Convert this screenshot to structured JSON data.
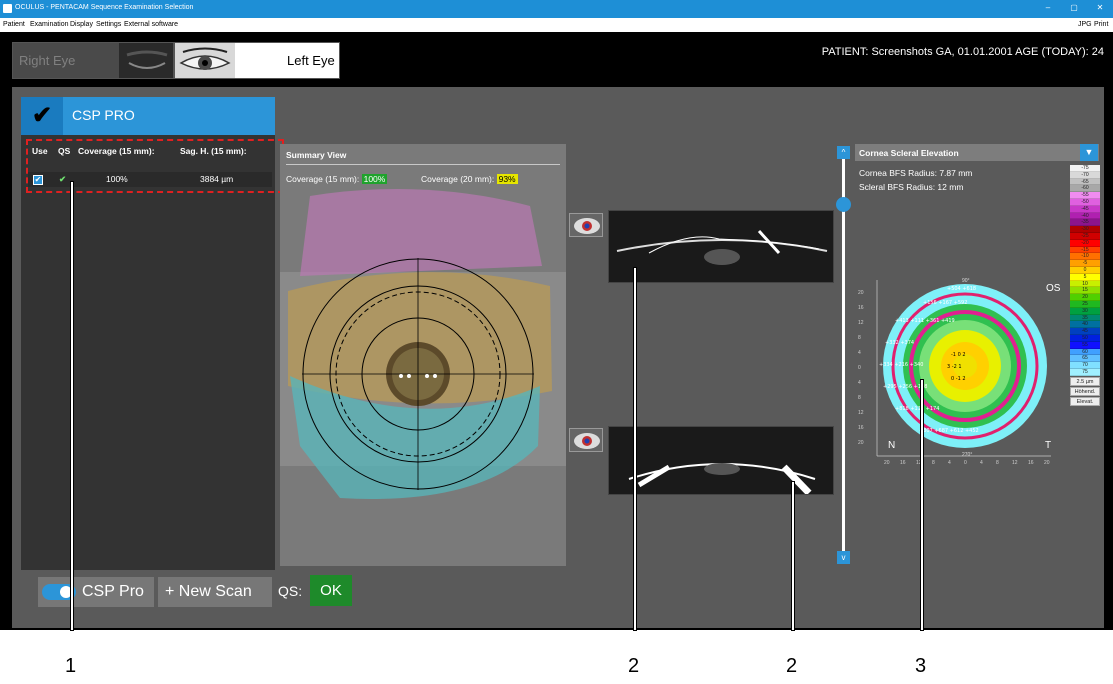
{
  "window": {
    "title": "OCULUS - PENTACAM Sequence Examination Selection",
    "controls": [
      "–",
      "▢",
      "✕"
    ]
  },
  "menu": {
    "items": [
      "Patient",
      "Examination",
      "Display",
      "Settings",
      "External software"
    ],
    "right_items": [
      "JPG",
      "Print"
    ]
  },
  "eyes": {
    "right_label": "Right Eye",
    "left_label": "Left Eye",
    "selected": "Left Eye"
  },
  "patient_info": "PATIENT: Screenshots GA, 01.01.2001   AGE (TODAY): 24",
  "csp": {
    "check": "✔",
    "title": "CSP PRO"
  },
  "scan_table": {
    "headers": [
      "Use",
      "QS",
      "Coverage (15 mm):",
      "Sag. H. (15 mm):"
    ],
    "rows": [
      {
        "use": "✔",
        "qs": "✔",
        "coverage": "100%",
        "sag": "3884 µm"
      }
    ]
  },
  "summary": {
    "title": "Summary View",
    "coverage15_label": "Coverage (15 mm):",
    "coverage15_value": "100%",
    "coverage20_label": "Coverage (20 mm):",
    "coverage20_value": "93%"
  },
  "bottom": {
    "csp_pro_label": "CSP Pro",
    "new_scan_label": "+ New Scan",
    "qs_label": "QS:",
    "qs_value": "OK"
  },
  "slider": {
    "up": "^",
    "down": "v"
  },
  "map": {
    "title": "Cornea Scleral Elevation",
    "dropdown": "▼",
    "cornea_bfs": "Cornea BFS Radius: 7.87 mm",
    "scleral_bfs": "Scleral BFS Radius: 12 mm",
    "eye_label": "OS",
    "nasal": "N",
    "temporal": "T",
    "top_angle": "90°",
    "bottom_angle": "270°",
    "axis_ticks": [
      "20",
      "16",
      "12",
      "8",
      "4",
      "0",
      "4",
      "8",
      "12",
      "16",
      "20"
    ]
  },
  "legend": {
    "entries": [
      {
        "v": "-75",
        "c": "#f2f2f2"
      },
      {
        "v": "-70",
        "c": "#d9d9d9"
      },
      {
        "v": "-65",
        "c": "#c0c0c0"
      },
      {
        "v": "-60",
        "c": "#a8a8a8"
      },
      {
        "v": "-55",
        "c": "#f08cf0"
      },
      {
        "v": "-50",
        "c": "#e060e0"
      },
      {
        "v": "-45",
        "c": "#c838c8"
      },
      {
        "v": "-40",
        "c": "#b020b0"
      },
      {
        "v": "-35",
        "c": "#8c148c"
      },
      {
        "v": "-30",
        "c": "#b00000"
      },
      {
        "v": "-25",
        "c": "#d00000"
      },
      {
        "v": "-20",
        "c": "#ff0000"
      },
      {
        "v": "-15",
        "c": "#ff4000"
      },
      {
        "v": "-10",
        "c": "#ff7000"
      },
      {
        "v": "-5",
        "c": "#ffa000"
      },
      {
        "v": "0",
        "c": "#ffd000"
      },
      {
        "v": "5",
        "c": "#ffff00"
      },
      {
        "v": "10",
        "c": "#c8f000"
      },
      {
        "v": "15",
        "c": "#90e000"
      },
      {
        "v": "20",
        "c": "#50d000"
      },
      {
        "v": "25",
        "c": "#20b820"
      },
      {
        "v": "30",
        "c": "#00a040"
      },
      {
        "v": "35",
        "c": "#008870"
      },
      {
        "v": "40",
        "c": "#0070a0"
      },
      {
        "v": "45",
        "c": "#0040c0"
      },
      {
        "v": "50",
        "c": "#0020e0"
      },
      {
        "v": "55",
        "c": "#1010ff"
      },
      {
        "v": "60",
        "c": "#40a0ff"
      },
      {
        "v": "65",
        "c": "#60c0ff"
      },
      {
        "v": "70",
        "c": "#80e0ff"
      },
      {
        "v": "75",
        "c": "#a0f0ff"
      }
    ],
    "step": "2.5 µm",
    "mode1": "Höhend.",
    "mode2": "Elevat."
  },
  "map_values": {
    "outer": [
      "+504",
      "+618",
      "+499",
      "+156",
      "+167",
      "+592",
      "+548",
      "+166",
      "+546",
      "+413",
      "+111",
      "+361",
      "+419",
      "+332",
      "+374",
      "+378",
      "+321",
      "+216",
      "+334",
      "+340",
      "+892",
      "+363",
      "+216",
      "+295",
      "+256",
      "+198",
      "+818",
      "+110",
      "+174",
      "+768",
      "+807",
      "+687",
      "+612",
      "+452"
    ],
    "inner": [
      "-5",
      "-1",
      "0",
      "2",
      "3",
      "-2",
      "1",
      "0",
      "-1",
      "2",
      "-3",
      "1",
      "4",
      "-1",
      "0",
      "3",
      "-2",
      "1"
    ]
  },
  "callouts": [
    "1",
    "2",
    "2",
    "3"
  ]
}
